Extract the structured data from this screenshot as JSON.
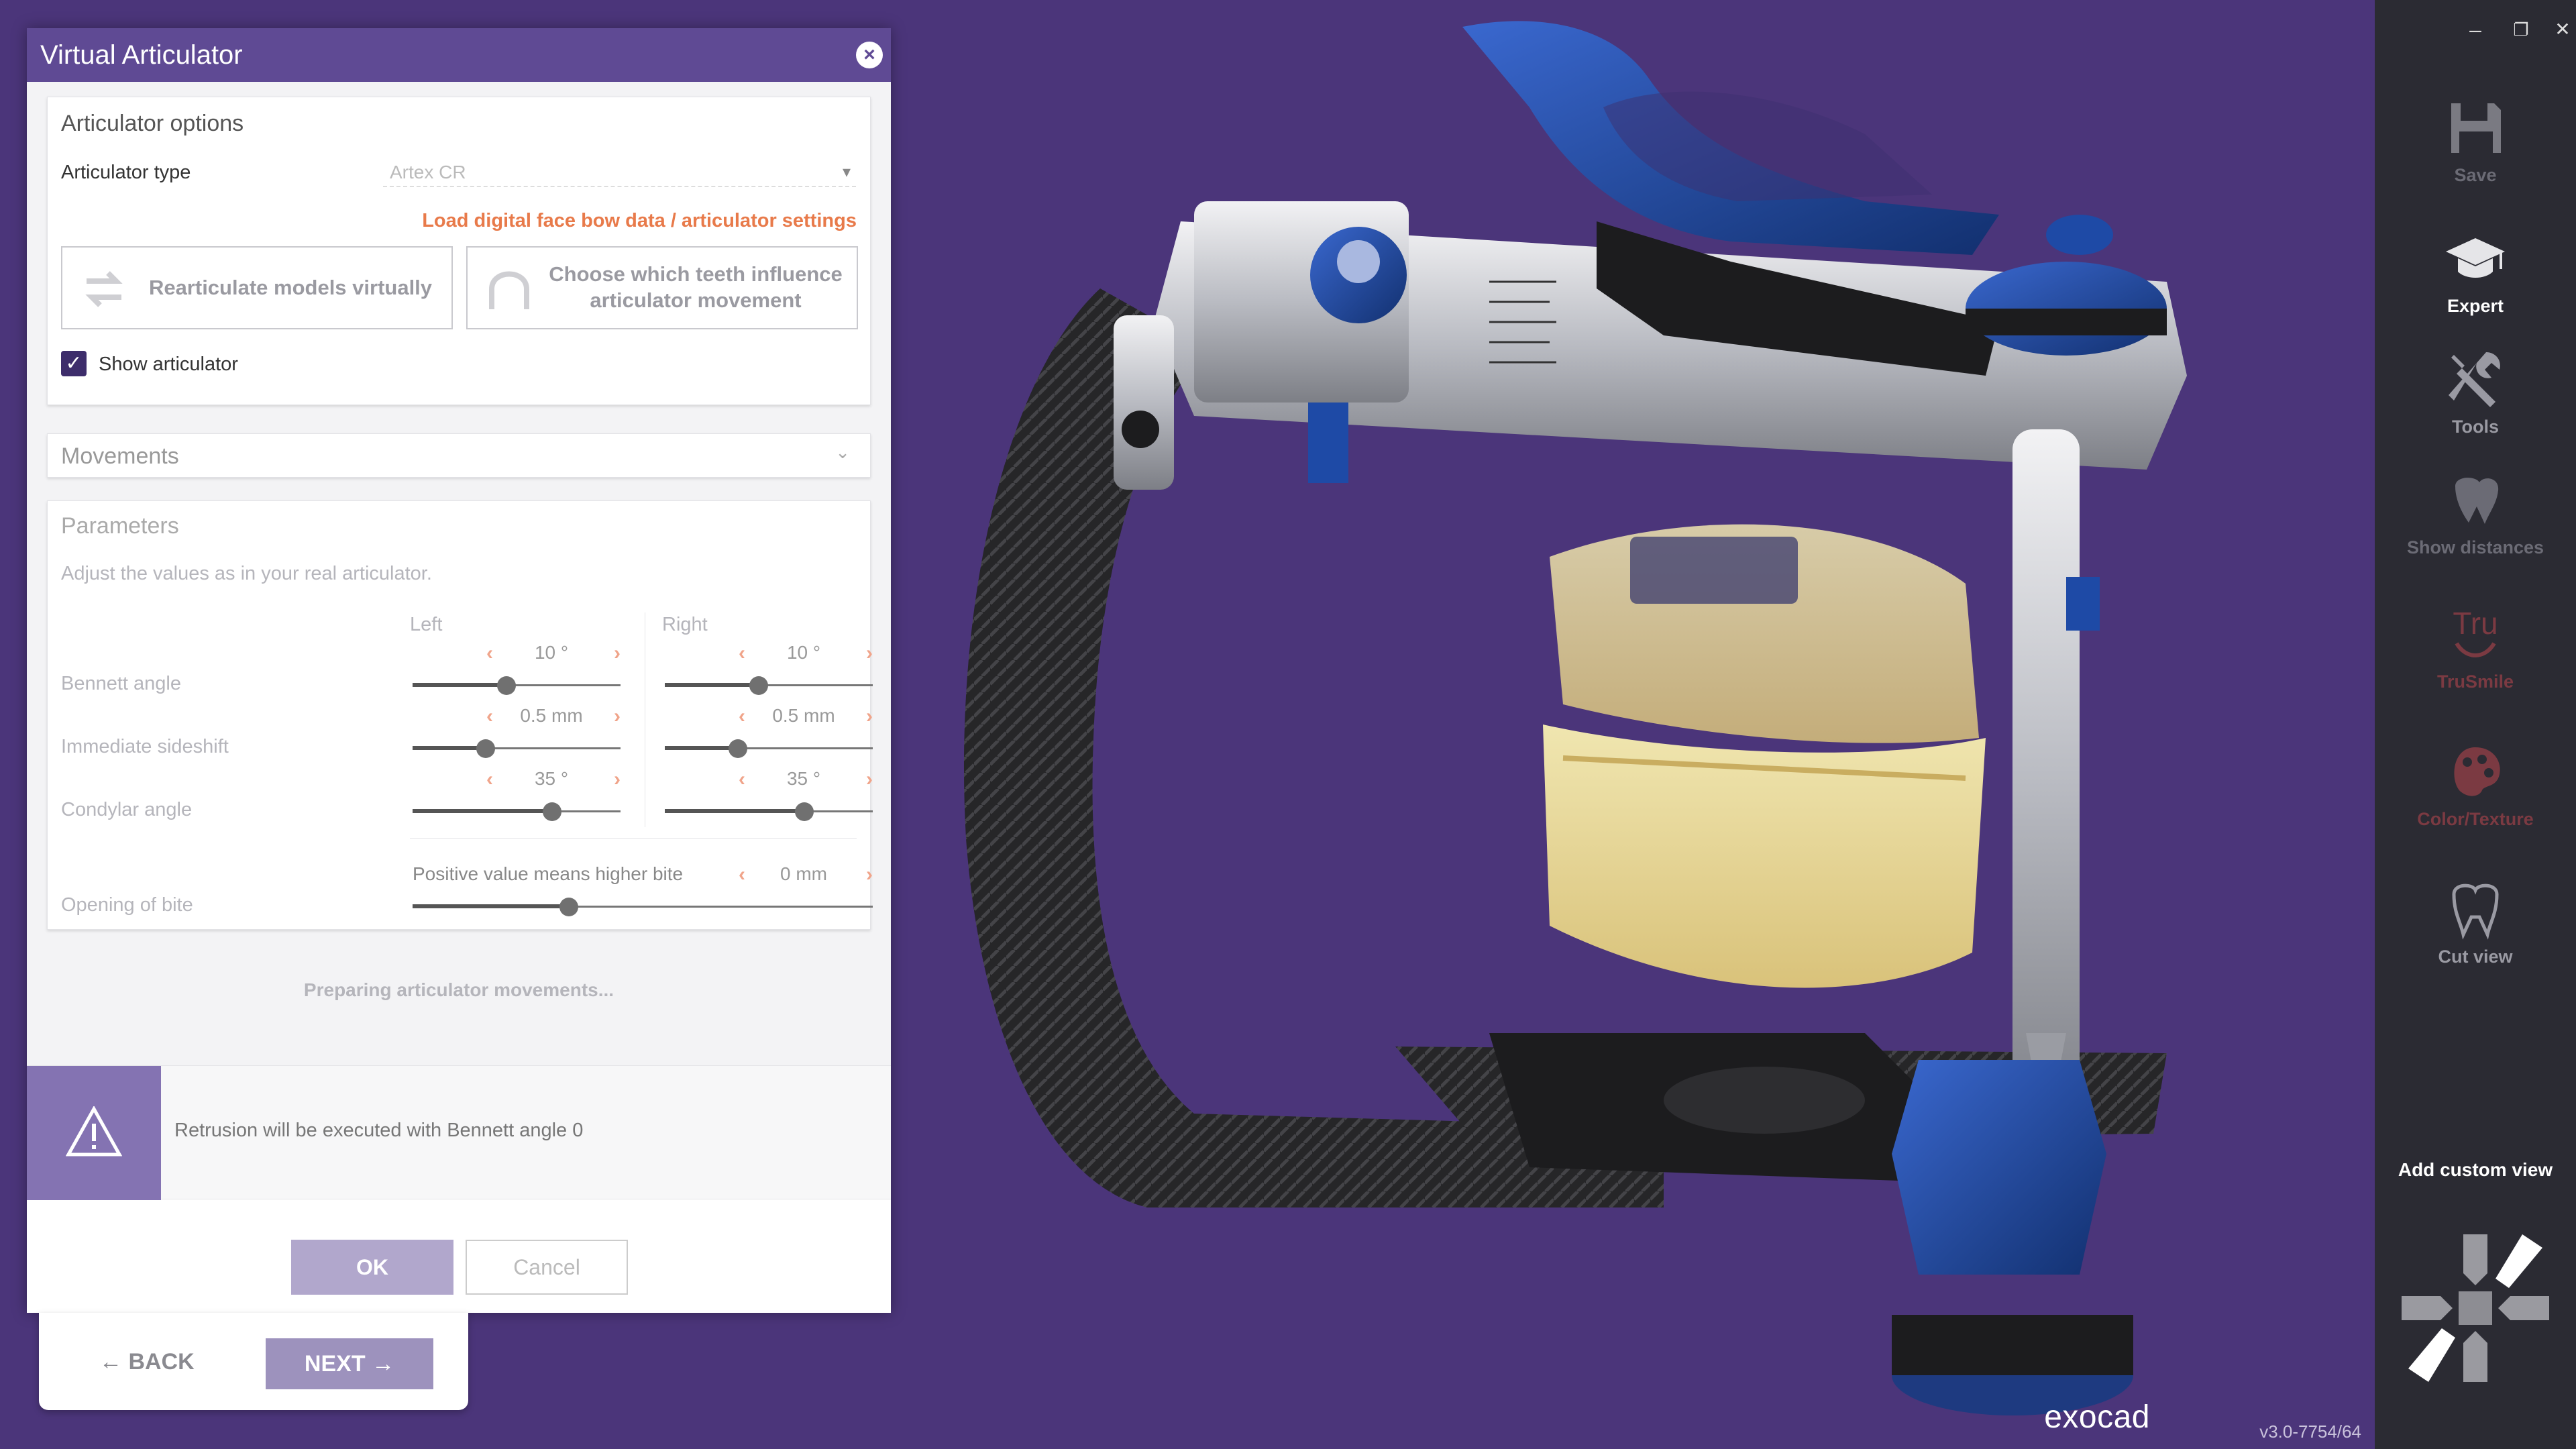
{
  "dialog": {
    "title": "Virtual Articulator",
    "close_symbol": "×"
  },
  "options": {
    "header": "Articulator options",
    "type_label": "Articulator type",
    "type_value": "Artex CR",
    "load_link": "Load digital face bow data / articulator settings",
    "rearticulate_btn": "Rearticulate models virtually",
    "choose_teeth_btn": "Choose which teeth influence articulator movement",
    "show_articulator_label": "Show articulator",
    "show_articulator_checked": true
  },
  "movements": {
    "header": "Movements"
  },
  "parameters": {
    "header": "Parameters",
    "hint": "Adjust the values as in your real articulator.",
    "left_label": "Left",
    "right_label": "Right",
    "bennett_label": "Bennett angle",
    "bennett_left": "10 °",
    "bennett_right": "10 °",
    "bennett_left_level": 0.45,
    "bennett_right_level": 0.45,
    "sideshift_label": "Immediate sideshift",
    "sideshift_left": "0.5 mm",
    "sideshift_right": "0.5 mm",
    "sideshift_left_level": 0.35,
    "sideshift_right_level": 0.35,
    "condylar_label": "Condylar angle",
    "condylar_left": "35 °",
    "condylar_right": "35 °",
    "condylar_left_level": 0.67,
    "condylar_right_level": 0.67,
    "bite_label": "Opening of bite",
    "bite_hint": "Positive value means higher bite",
    "bite_value": "0 mm",
    "bite_level": 0.34
  },
  "status": "Preparing articulator movements...",
  "warning": "Retrusion will be executed with Bennett angle 0",
  "buttons": {
    "ok": "OK",
    "cancel": "Cancel"
  },
  "wizard": {
    "back": "BACK",
    "next": "NEXT"
  },
  "toolbar": {
    "minimize": "–",
    "restore": "❐",
    "close": "✕",
    "save": "Save",
    "expert": "Expert",
    "tools": "Tools",
    "show_distances": "Show distances",
    "trusmile": "TruSmile",
    "color_texture": "Color/Texture",
    "cut_view": "Cut view",
    "add_custom_view": "Add custom view"
  },
  "brand": "exocad",
  "version": "v3.0-7754/64",
  "colors": {
    "viewport_bg": "#4b357a",
    "title_bar": "#5f4a94",
    "accent_link": "#e87a4a",
    "model_blue": "#1e4aa6",
    "toolbar_bg": "#2b2b33"
  }
}
